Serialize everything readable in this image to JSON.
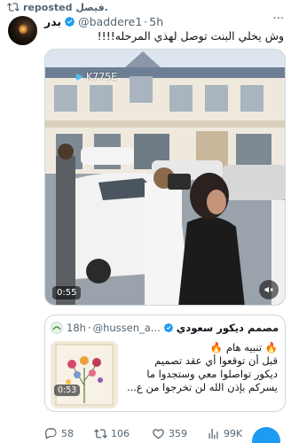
{
  "repost": {
    "label": "reposted",
    "by": "فيصل."
  },
  "tweet": {
    "author_name": "بدر",
    "author_handle": "@baddere1",
    "separator": "·",
    "time": "5h",
    "more": "···",
    "text": "وش يخلي البنت توصل لهذي المرحله!!!!",
    "media": {
      "plate_text": "K775E",
      "duration": "0:55"
    }
  },
  "quote": {
    "author_name": "مصمم ديكور سعودي",
    "author_handle": "@hussen_a...",
    "separator": "·",
    "time": "18h",
    "thumb_duration": "0:53",
    "lines": [
      "🔥 تنبيه هام 🔥",
      "قبل أن توقعوا أي عقد تصميم",
      "ديكور تواصلوا معي وستجدوا ما",
      "يسركم بإذن الله لن تخرجوا من ع..."
    ]
  },
  "actions": {
    "replies": "58",
    "reposts": "106",
    "likes": "359",
    "views": "99K"
  },
  "colors": {
    "accent": "#1d9bf0",
    "secondary_text": "#536471",
    "repost_green": "#00ba7c"
  }
}
